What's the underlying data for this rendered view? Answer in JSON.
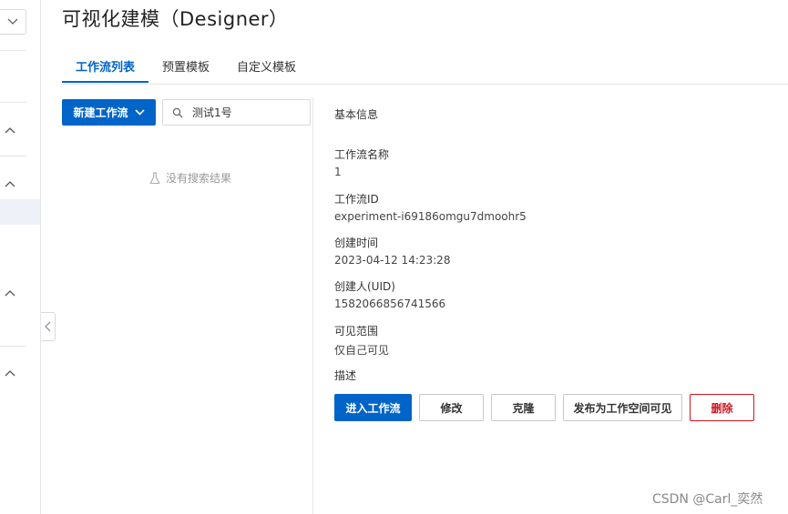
{
  "header": {
    "title": "可视化建模（Designer）"
  },
  "tabs": [
    {
      "label": "工作流列表",
      "active": true
    },
    {
      "label": "预置模板",
      "active": false
    },
    {
      "label": "自定义模板",
      "active": false
    }
  ],
  "list_panel": {
    "new_button_label": "新建工作流",
    "search_value": "测试1号",
    "empty_text": "没有搜索结果"
  },
  "detail": {
    "section_title": "基本信息",
    "fields": [
      {
        "label": "工作流名称",
        "value": "1"
      },
      {
        "label": "工作流ID",
        "value": "experiment-i69186omgu7dmoohr5"
      },
      {
        "label": "创建时间",
        "value": "2023-04-12 14:23:28"
      },
      {
        "label": "创建人(UID)",
        "value": "1582066856741566"
      },
      {
        "label": "可见范围",
        "value": "仅自己可见"
      },
      {
        "label": "描述",
        "value": ""
      }
    ],
    "actions": {
      "enter": "进入工作流",
      "edit": "修改",
      "clone": "克隆",
      "publish": "发布为工作空间可见",
      "delete": "删除"
    }
  },
  "watermark": "CSDN @Carl_奕然",
  "colors": {
    "primary": "#0064c8",
    "danger": "#d0151f"
  }
}
